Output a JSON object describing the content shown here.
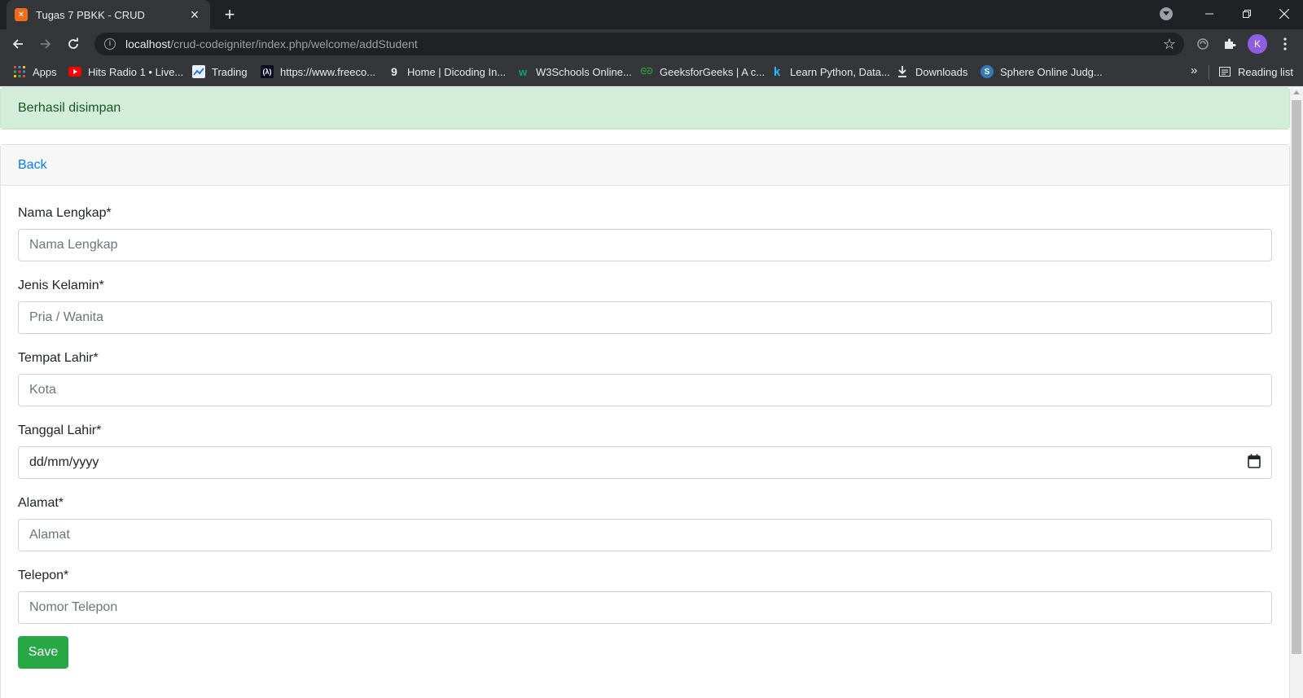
{
  "browser": {
    "tab_title": "Tugas 7 PBKK - CRUD",
    "url_host": "localhost",
    "url_path": "/crud-codeigniter/index.php/welcome/addStudent",
    "profile_initial": "K",
    "bookmarks": [
      {
        "label": "Apps",
        "icon": "apps-grid-icon"
      },
      {
        "label": "Hits Radio 1 • Live...",
        "icon": "youtube-icon"
      },
      {
        "label": "Trading",
        "icon": "trading-icon"
      },
      {
        "label": "https://www.freeco...",
        "icon": "freecodecamp-icon"
      },
      {
        "label": "Home | Dicoding In...",
        "icon": "dicoding-icon"
      },
      {
        "label": "W3Schools Online...",
        "icon": "w3schools-icon"
      },
      {
        "label": "GeeksforGeeks | A c...",
        "icon": "geeksforgeeks-icon"
      },
      {
        "label": "Learn Python, Data...",
        "icon": "kaggle-icon"
      },
      {
        "label": "Downloads",
        "icon": "download-icon"
      },
      {
        "label": "Sphere Online Judg...",
        "icon": "spoj-icon"
      }
    ],
    "more_label": "»",
    "reading_list_label": "Reading list"
  },
  "page": {
    "alert_text": "Berhasil disimpan",
    "back_label": "Back",
    "fields": [
      {
        "label": "Nama Lengkap*",
        "placeholder": "Nama Lengkap"
      },
      {
        "label": "Jenis Kelamin*",
        "placeholder": "Pria / Wanita"
      },
      {
        "label": "Tempat Lahir*",
        "placeholder": "Kota"
      },
      {
        "label": "Tanggal Lahir*",
        "placeholder": "dd/mm/yyyy"
      },
      {
        "label": "Alamat*",
        "placeholder": "Alamat"
      },
      {
        "label": "Telepon*",
        "placeholder": "Nomor Telepon"
      }
    ],
    "save_label": "Save"
  },
  "colors": {
    "alert_bg": "#d4edda",
    "alert_text": "#155724",
    "link": "#007bff",
    "save_button": "#28a745"
  }
}
